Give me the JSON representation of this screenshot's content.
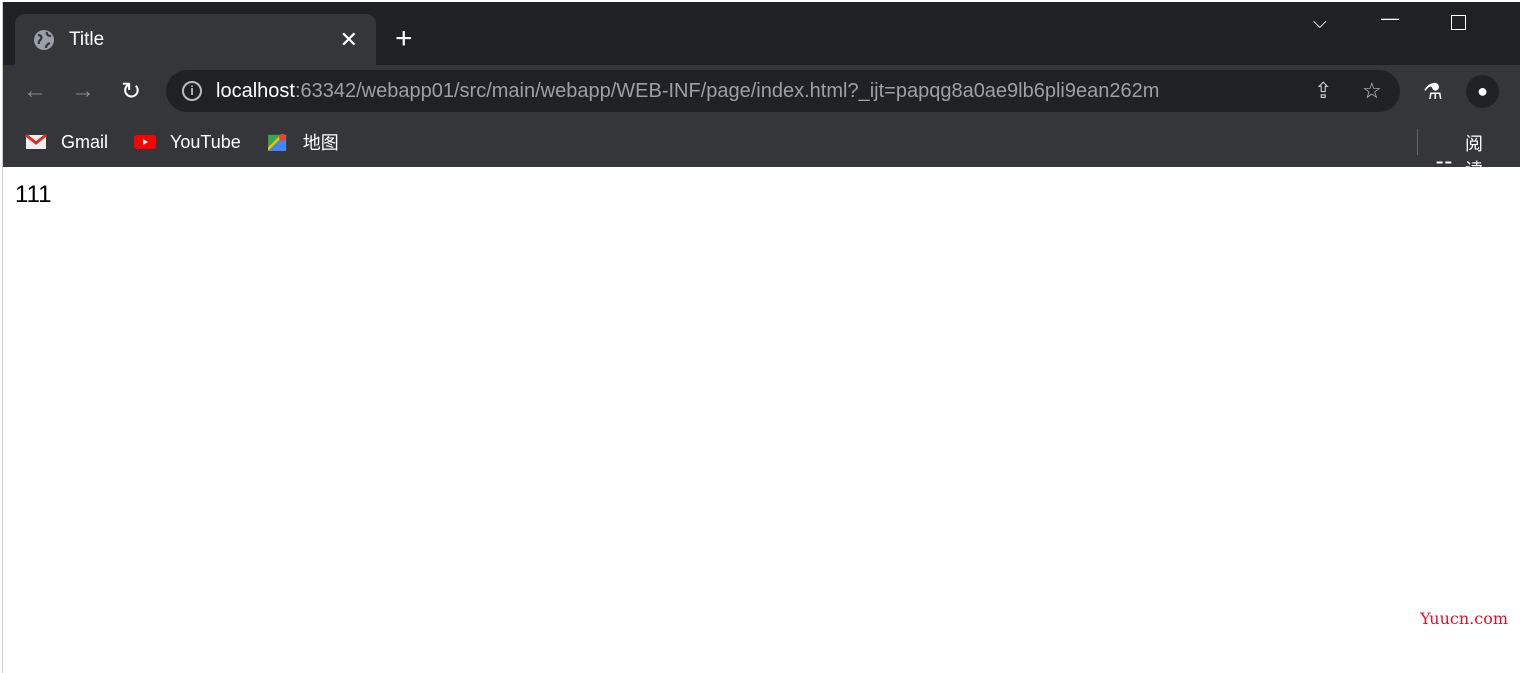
{
  "tab": {
    "title": "Title",
    "icon": "globe-icon"
  },
  "window": {
    "controls": [
      "tab-search",
      "minimize",
      "maximize"
    ]
  },
  "toolbar": {
    "host": "localhost",
    "url_rest": ":63342/webapp01/src/main/webapp/WEB-INF/page/index.html?_ijt=papqg8a0ae9lb6pli9ean262m"
  },
  "bookmarks": [
    {
      "label": "Gmail"
    },
    {
      "label": "YouTube"
    },
    {
      "label": "地图"
    }
  ],
  "reading_list": {
    "label": "阅读清"
  },
  "page": {
    "text": "111"
  },
  "watermark": "Yuucn.com",
  "colors": {
    "titlebar": "#202124",
    "toolbar": "#35363a",
    "watermark": "#e0102a"
  }
}
